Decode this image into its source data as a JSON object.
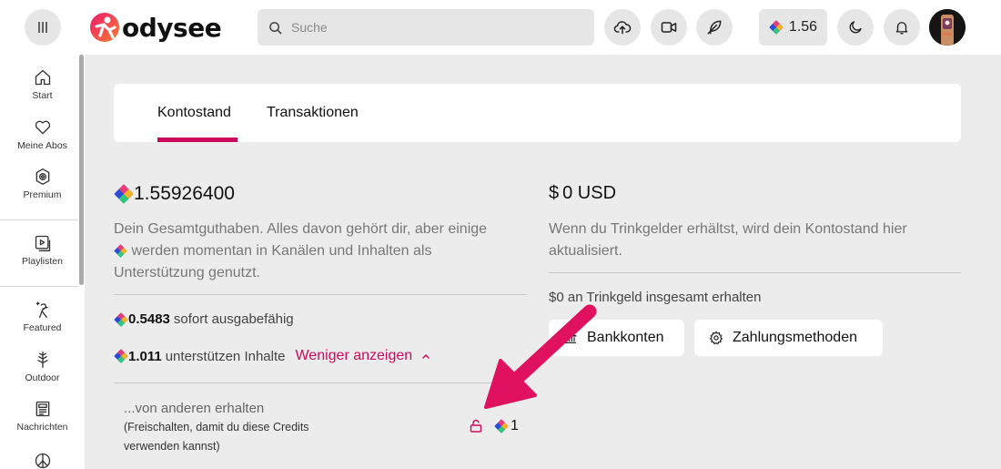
{
  "header": {
    "logo_text": "odysee",
    "search_placeholder": "Suche",
    "balance": "1.56"
  },
  "sidebar": {
    "items": [
      {
        "label": "Start",
        "icon": "home-icon"
      },
      {
        "label": "Meine Abos",
        "icon": "heart-icon"
      },
      {
        "label": "Premium",
        "icon": "premium-icon"
      },
      {
        "label": "Playlisten",
        "icon": "playlist-icon"
      },
      {
        "label": "Featured",
        "icon": "featured-icon"
      },
      {
        "label": "Outdoor",
        "icon": "tree-icon"
      },
      {
        "label": "Nachrichten",
        "icon": "newspaper-icon"
      }
    ]
  },
  "tabs": [
    {
      "label": "Kontostand",
      "active": true
    },
    {
      "label": "Transaktionen",
      "active": false
    }
  ],
  "lbc": {
    "total": "1.55926400",
    "description_line1": "Dein Gesamtguthaben. Alles davon gehört dir, aber einige",
    "description_line2": "werden momentan in Kanälen und Inhalten als",
    "description_line3": "Unterstützung genutzt.",
    "spendable_value": "0.5483",
    "spendable_label": "sofort ausgabefähig",
    "supporting_value": "1.011",
    "supporting_label": "unterstützen Inhalte",
    "show_less": "Weniger anzeigen",
    "received_title": "...von anderen erhalten",
    "received_note": "(Freischalten, damit du diese Credits verwenden kannst)",
    "received_value": "1"
  },
  "usd": {
    "symbol": "$",
    "total": "0 USD",
    "description_line1": "Wenn du Trinkgelder erhältst, wird dein Kontostand hier",
    "description_line2": "aktualisiert.",
    "tips_total": "$0 an Trinkgeld insgesamt erhalten",
    "bank_button": "Bankkonten",
    "payment_button": "Zahlungsmethoden"
  },
  "colors": {
    "accent": "#cc0a5d",
    "background": "#ececec"
  }
}
